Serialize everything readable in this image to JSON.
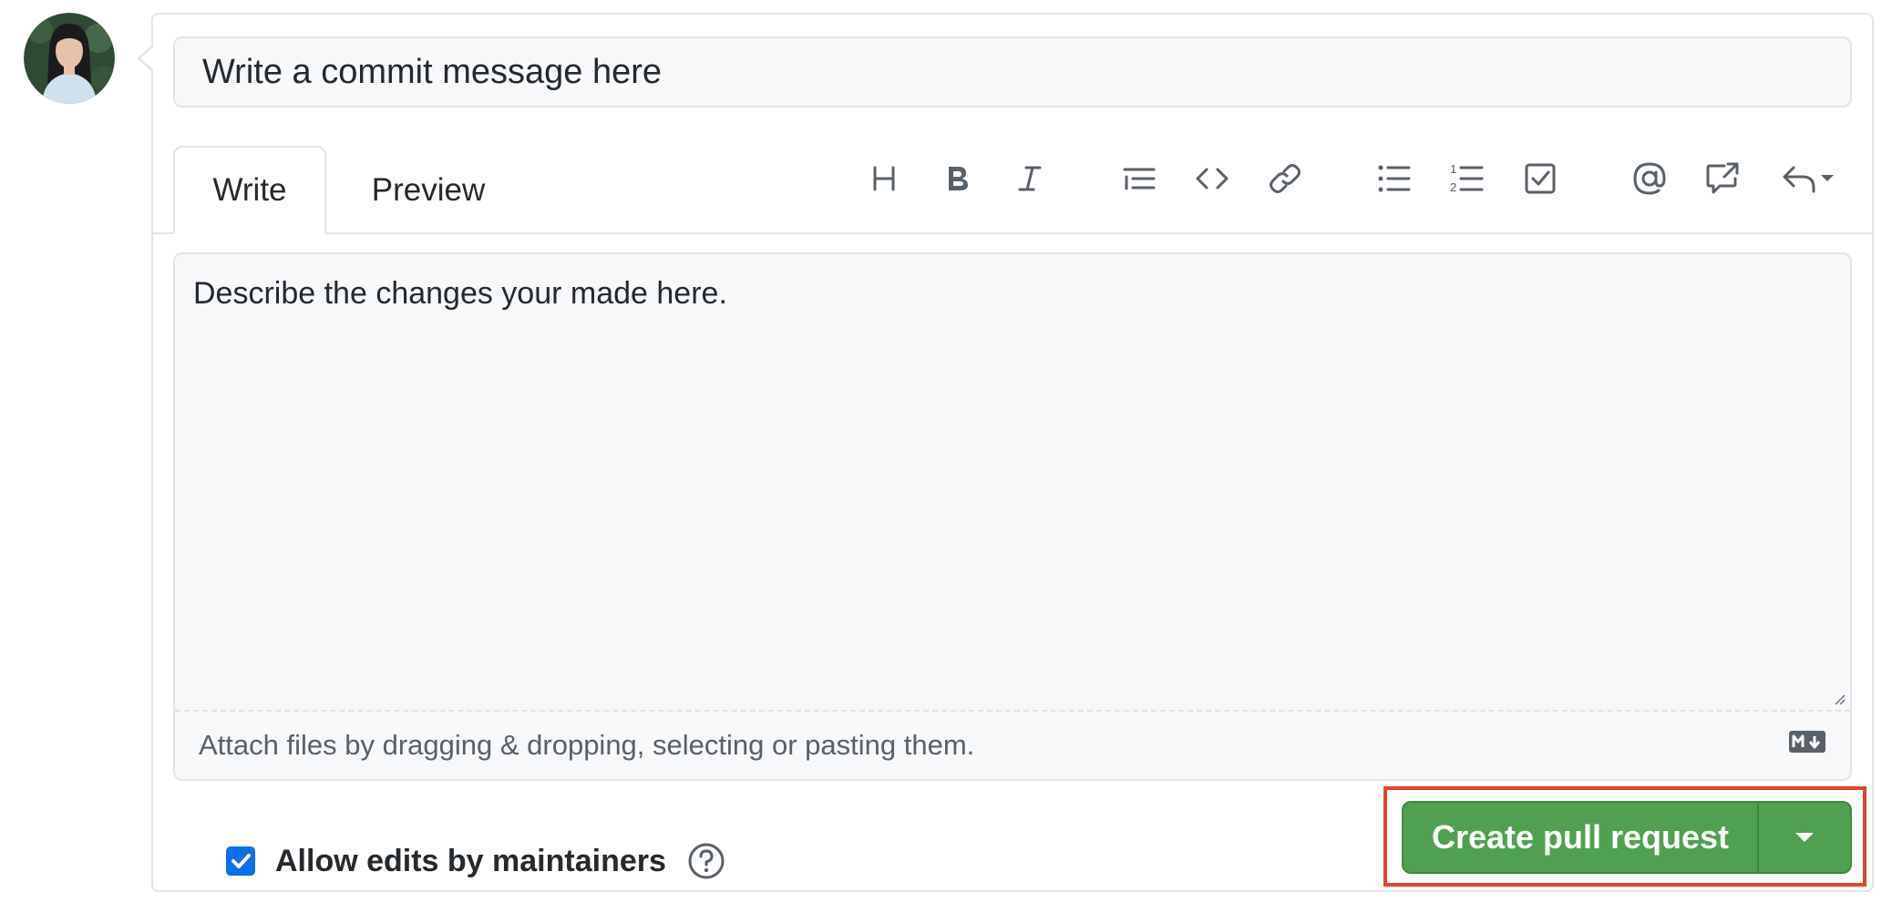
{
  "composer": {
    "title_placeholder": "Write a commit message here",
    "tabs": [
      {
        "label": "Write",
        "active": true
      },
      {
        "label": "Preview",
        "active": false
      }
    ],
    "toolbar_icons": [
      "heading-icon",
      "bold-icon",
      "italic-icon",
      "quote-icon",
      "code-icon",
      "link-icon",
      "unordered-list-icon",
      "ordered-list-icon",
      "task-list-icon",
      "mention-icon",
      "cross-reference-icon",
      "reply-icon"
    ],
    "body_placeholder": "Describe the changes your made here.",
    "attach_text": "Attach files by dragging & dropping, selecting or pasting them."
  },
  "options": {
    "allow_edits_label": "Allow edits by maintainers",
    "allow_edits_checked": true
  },
  "actions": {
    "create_label": "Create pull request"
  },
  "colors": {
    "primary_green": "#4fa150",
    "checkbox_blue": "#0b6eef",
    "highlight_red": "#e3442d",
    "border": "#e1e4e8",
    "input_bg": "#f6f8fa"
  }
}
